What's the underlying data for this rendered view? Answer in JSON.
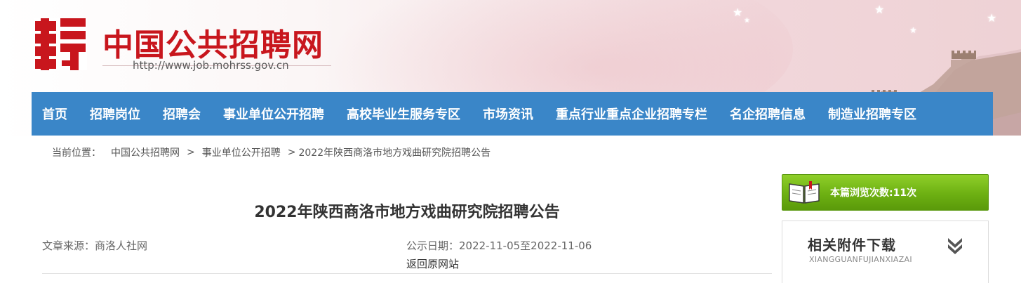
{
  "header": {
    "site_title": "中国公共招聘网",
    "site_url": "http://www.job.mohrss.gov.cn",
    "logo_icon": "pin-character-logo",
    "brand_color": "#c8161d"
  },
  "nav": {
    "background": "#3a86c8",
    "items": [
      {
        "label": "首页"
      },
      {
        "label": "招聘岗位"
      },
      {
        "label": "招聘会"
      },
      {
        "label": "事业单位公开招聘"
      },
      {
        "label": "高校毕业生服务专区"
      },
      {
        "label": "市场资讯"
      },
      {
        "label": "重点行业重点企业招聘专栏"
      },
      {
        "label": "名企招聘信息"
      },
      {
        "label": "制造业招聘专区"
      }
    ]
  },
  "breadcrumb": {
    "prefix": "当前位置：",
    "items": [
      {
        "label": "中国公共招聘网"
      },
      {
        "label": "事业单位公开招聘"
      }
    ],
    "separator": ">",
    "current": "2022年陕西商洛市地方戏曲研究院招聘公告"
  },
  "article": {
    "title": "2022年陕西商洛市地方戏曲研究院招聘公告",
    "source": "文章来源：商洛人社网",
    "date": "公示日期：2022-11-05至2022-11-06",
    "back_link": "返回原网站"
  },
  "sidebar": {
    "views_label": "本篇浏览次数:",
    "views_count": "11次",
    "views_icon": "open-book-icon",
    "attachments_title": "相关附件下载",
    "attachments_subtitle": "XIANGGUANFUJIANXIAZAI",
    "attachments_icon": "double-chevron-down-icon",
    "accent_green": "#6db012"
  }
}
